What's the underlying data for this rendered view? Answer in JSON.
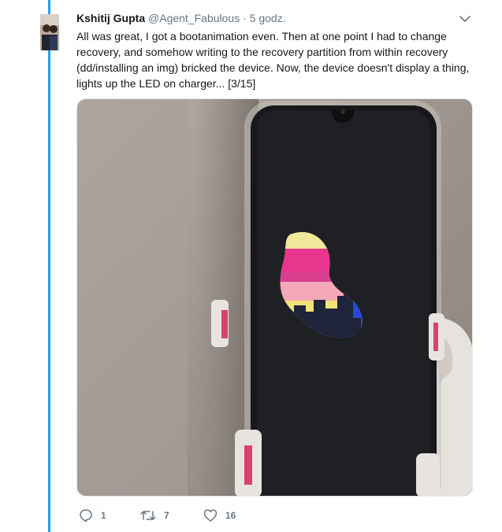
{
  "tweet": {
    "author_name": "Kshitij Gupta",
    "author_handle": "@Agent_Fabulous",
    "separator": "·",
    "time": "5 godz.",
    "text": "All was great, I got a bootanimation even. Then at one point I had to change recovery, and somehow writing to the recovery partition from within recovery (dd/installing an img) bricked the device. Now, the device doesn't display a thing, lights up the LED on charger... [3/15]",
    "media_description": "Phone in a transparent case on a stand, black screen showing a colorful blob-shaped boot animation with city skyline silhouette"
  },
  "actions": {
    "replies": "1",
    "retweets": "7",
    "likes": "16"
  },
  "icons": [
    "reply-icon",
    "retweet-icon",
    "like-icon",
    "chevron-down-icon"
  ],
  "colors": {
    "thread_line": "#1da1f2",
    "name": "#14171a",
    "muted": "#657786",
    "blob_pink": "#e8368f",
    "blob_yellow": "#f1e27a",
    "blob_blue": "#2a46d8"
  }
}
